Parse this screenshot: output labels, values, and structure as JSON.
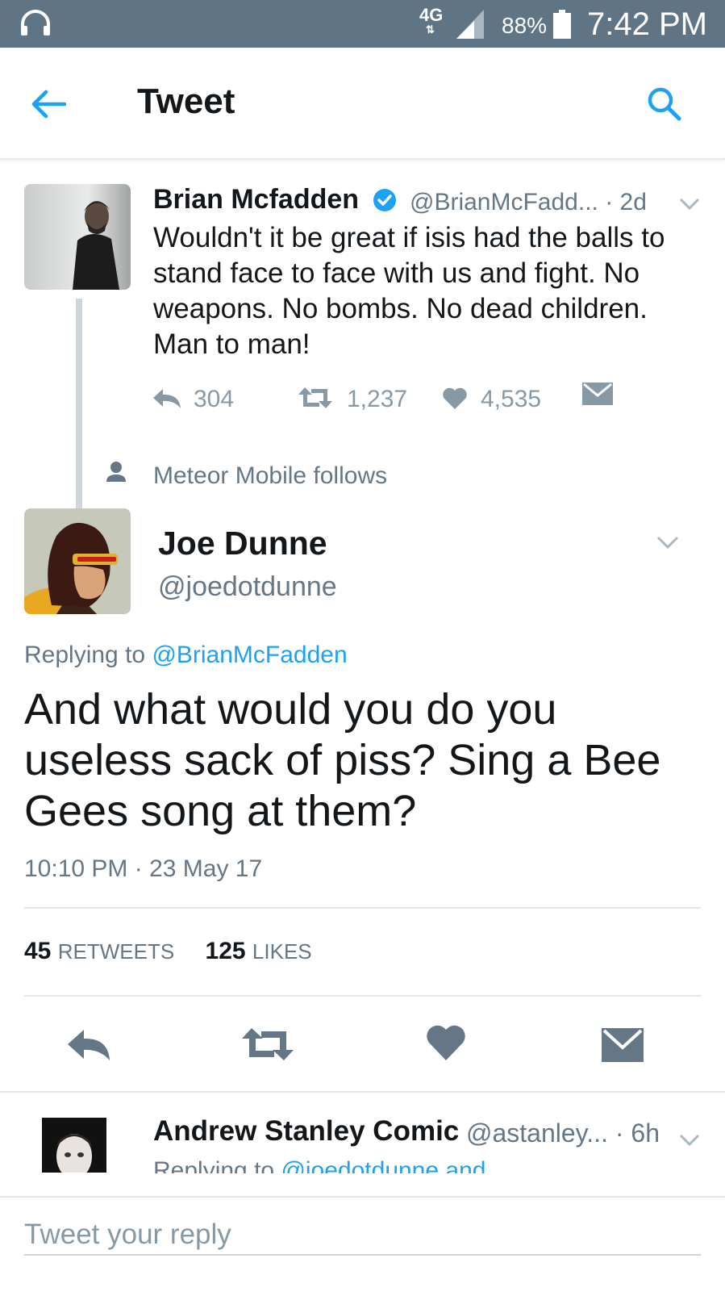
{
  "status_bar": {
    "network": "4G",
    "battery": "88%",
    "time": "7:42 PM"
  },
  "header": {
    "title": "Tweet"
  },
  "parent_tweet": {
    "name": "Brian Mcfadden",
    "handle": "@BrianMcFadd...",
    "age": "· 2d",
    "text": "Wouldn't it be great if isis had the balls to stand face to face with us and fight. No weapons. No bombs. No dead children. Man to man!",
    "replies": "304",
    "retweets": "1,237",
    "likes": "4,535"
  },
  "social_context": {
    "text": "Meteor Mobile follows"
  },
  "main_tweet": {
    "name": "Joe Dunne",
    "handle": "@joedotdunne",
    "replying_prefix": "Replying to",
    "replying_to": "@BrianMcFadden",
    "text": "And what would you do you useless sack of piss? Sing a Bee Gees song at them?",
    "timestamp": "10:10 PM · 23 May 17",
    "retweet_count": "45",
    "retweet_label": "RETWEETS",
    "like_count": "125",
    "like_label": "LIKES"
  },
  "next_reply": {
    "name": "Andrew Stanley Comic",
    "handle": "@astanley...",
    "age": "· 6h",
    "replying_prefix": "Replying to",
    "replying_to": "@joedotdunne and"
  },
  "reply_box": {
    "placeholder": "Tweet your reply"
  },
  "colors": {
    "status_bar": "#5f7585",
    "accent": "#1da1f2",
    "secondary_text": "#657786",
    "icon_gray": "#657786"
  }
}
